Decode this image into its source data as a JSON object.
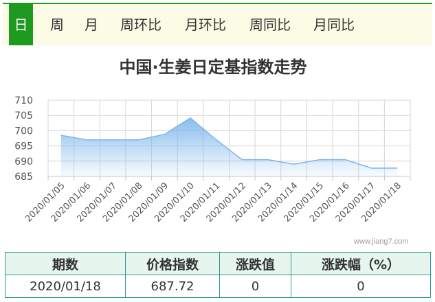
{
  "tabs": [
    {
      "label": "日",
      "active": true
    },
    {
      "label": "周",
      "active": false
    },
    {
      "label": "月",
      "active": false
    },
    {
      "label": "周环比",
      "active": false
    },
    {
      "label": "月环比",
      "active": false
    },
    {
      "label": "周同比",
      "active": false
    },
    {
      "label": "月同比",
      "active": false
    }
  ],
  "watermark": "www.jiang7.com",
  "chart_data": {
    "type": "area",
    "title": "中国·生姜日定基指数走势",
    "x": [
      "2020/01/05",
      "2020/01/06",
      "2020/01/07",
      "2020/01/08",
      "2020/01/09",
      "2020/01/10",
      "2020/01/11",
      "2020/01/12",
      "2020/01/13",
      "2020/01/14",
      "2020/01/15",
      "2020/01/16",
      "2020/01/17",
      "2020/01/18"
    ],
    "series": [
      {
        "values": [
          698.5,
          697.0,
          697.0,
          697.0,
          698.8,
          704.2,
          697.0,
          690.5,
          690.5,
          689.0,
          690.5,
          690.5,
          687.7,
          687.72
        ]
      }
    ],
    "yticks": [
      685,
      690,
      695,
      700,
      705,
      710
    ],
    "ylim": [
      685,
      710
    ],
    "grid": true,
    "line_color": "#7cb5ec",
    "fill_top_color": "#7cb5ec"
  },
  "table": {
    "headers": [
      "期数",
      "价格指数",
      "涨跌值",
      "涨跌幅（%）"
    ],
    "rows": [
      [
        "2020/01/18",
        "687.72",
        "0",
        "0"
      ]
    ]
  }
}
